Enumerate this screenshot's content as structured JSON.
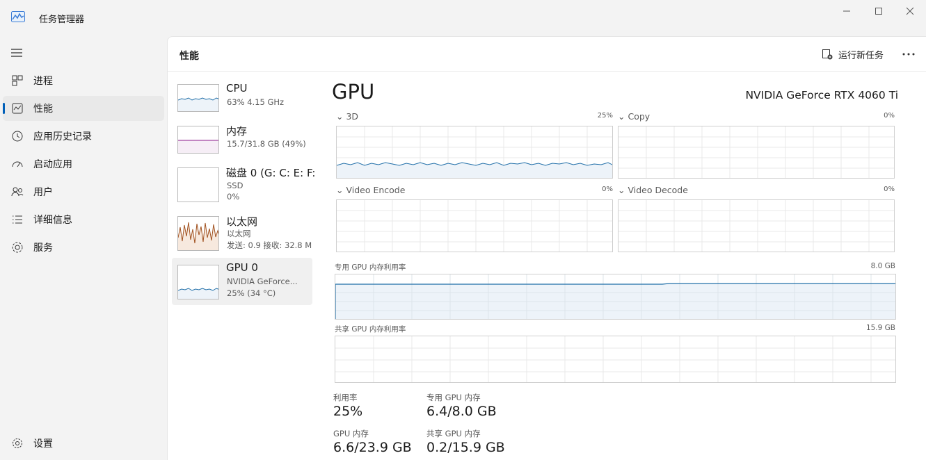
{
  "window": {
    "title": "任务管理器"
  },
  "nav": {
    "items": [
      {
        "label": "进程",
        "icon": "processes-icon"
      },
      {
        "label": "性能",
        "icon": "performance-icon",
        "active": true
      },
      {
        "label": "应用历史记录",
        "icon": "history-icon"
      },
      {
        "label": "启动应用",
        "icon": "startup-icon"
      },
      {
        "label": "用户",
        "icon": "users-icon"
      },
      {
        "label": "详细信息",
        "icon": "details-icon"
      },
      {
        "label": "服务",
        "icon": "services-icon"
      }
    ],
    "settings": "设置"
  },
  "header": {
    "title": "性能",
    "run_new_task": "运行新任务"
  },
  "resources": [
    {
      "name": "CPU",
      "sub1": "63%  4.15 GHz",
      "sub2": ""
    },
    {
      "name": "内存",
      "sub1": "15.7/31.8 GB (49%)",
      "sub2": ""
    },
    {
      "name": "磁盘 0 (G: C: E: F:",
      "sub1": "SSD",
      "sub2": "0%"
    },
    {
      "name": "以太网",
      "sub1": "以太网",
      "sub2": "发送: 0.9  接收: 32.8 M"
    },
    {
      "name": "GPU 0",
      "sub1": "NVIDIA GeForce...",
      "sub2": "25%  (34 °C)",
      "active": true
    }
  ],
  "gpu": {
    "title": "GPU",
    "model": "NVIDIA GeForce RTX 4060 Ti",
    "engines": [
      {
        "name": "3D",
        "pct": "25%"
      },
      {
        "name": "Copy",
        "pct": "0%"
      },
      {
        "name": "Video Encode",
        "pct": "0%"
      },
      {
        "name": "Video Decode",
        "pct": "0%"
      }
    ],
    "dedicated_mem_label": "专用 GPU 内存利用率",
    "dedicated_mem_max": "8.0 GB",
    "shared_mem_label": "共享 GPU 内存利用率",
    "shared_mem_max": "15.9 GB",
    "stats": {
      "utilization_label": "利用率",
      "utilization_value": "25%",
      "dedicated_label": "专用 GPU 内存",
      "dedicated_value": "6.4/8.0 GB",
      "gpu_mem_label": "GPU 内存",
      "gpu_mem_value": "6.6/23.9 GB",
      "shared_label": "共享 GPU 内存",
      "shared_value": "0.2/15.9 GB"
    }
  },
  "colors": {
    "accent": "#005fb8",
    "gpu_line": "#1f6ea8",
    "gpu_fill": "#edf3f9",
    "mem_line": "#8b1a8b",
    "net_line": "#a0501e",
    "net_fill": "#f7e9de"
  }
}
